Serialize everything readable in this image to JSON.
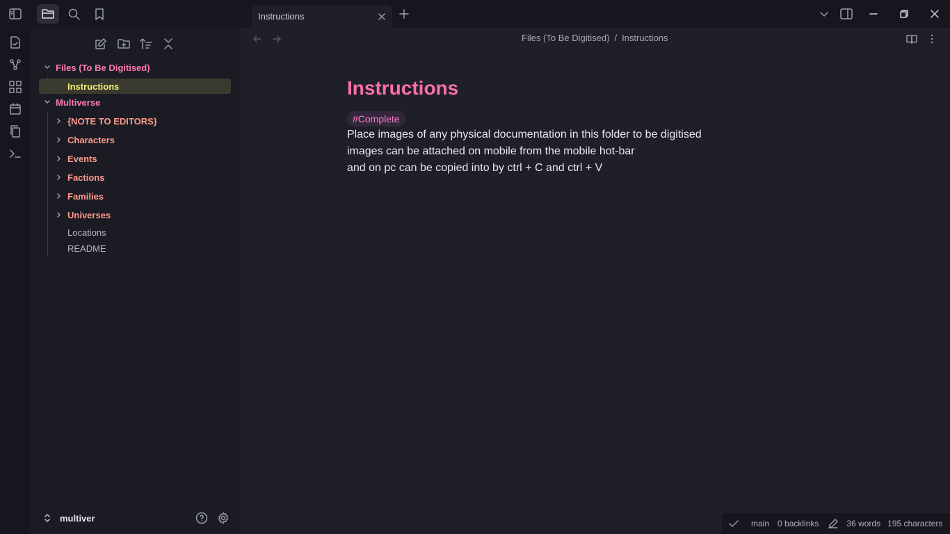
{
  "sidebar_tabs": [
    "files-tab",
    "search-tab",
    "bookmarks-tab"
  ],
  "file_tree": {
    "folders": [
      {
        "label": "Files (To Be Digitised)",
        "expanded": true,
        "children": [
          {
            "label": "Instructions",
            "active": true
          }
        ]
      },
      {
        "label": "Multiverse",
        "expanded": true,
        "children": [
          {
            "label": "{NOTE TO EDITORS}",
            "type": "folder"
          },
          {
            "label": "Characters",
            "type": "folder"
          },
          {
            "label": "Events",
            "type": "folder"
          },
          {
            "label": "Factions",
            "type": "folder"
          },
          {
            "label": "Families",
            "type": "folder"
          },
          {
            "label": "Universes",
            "type": "folder"
          },
          {
            "label": "Locations",
            "type": "file"
          },
          {
            "label": "README",
            "type": "file"
          }
        ]
      }
    ]
  },
  "vault": {
    "name": "multiver"
  },
  "tab": {
    "title": "Instructions"
  },
  "breadcrumb": {
    "folder": "Files (To Be Digitised)",
    "separator": "/",
    "file": "Instructions"
  },
  "document": {
    "title": "Instructions",
    "tag": "#Complete",
    "lines": [
      "Place images of any physical documentation in this folder to be digitised",
      "images can be attached on mobile from the mobile hot-bar",
      "and on pc can be copied into by ctrl + C and ctrl + V"
    ]
  },
  "status": {
    "branch": "main",
    "backlinks": "0 backlinks",
    "words": "36 words",
    "characters": "195 characters"
  },
  "colors": {
    "accent_pink": "#ff6fab",
    "folder_sub": "#ff9a8a",
    "active_file": "#f0f07c",
    "background": "#1e1f29"
  }
}
